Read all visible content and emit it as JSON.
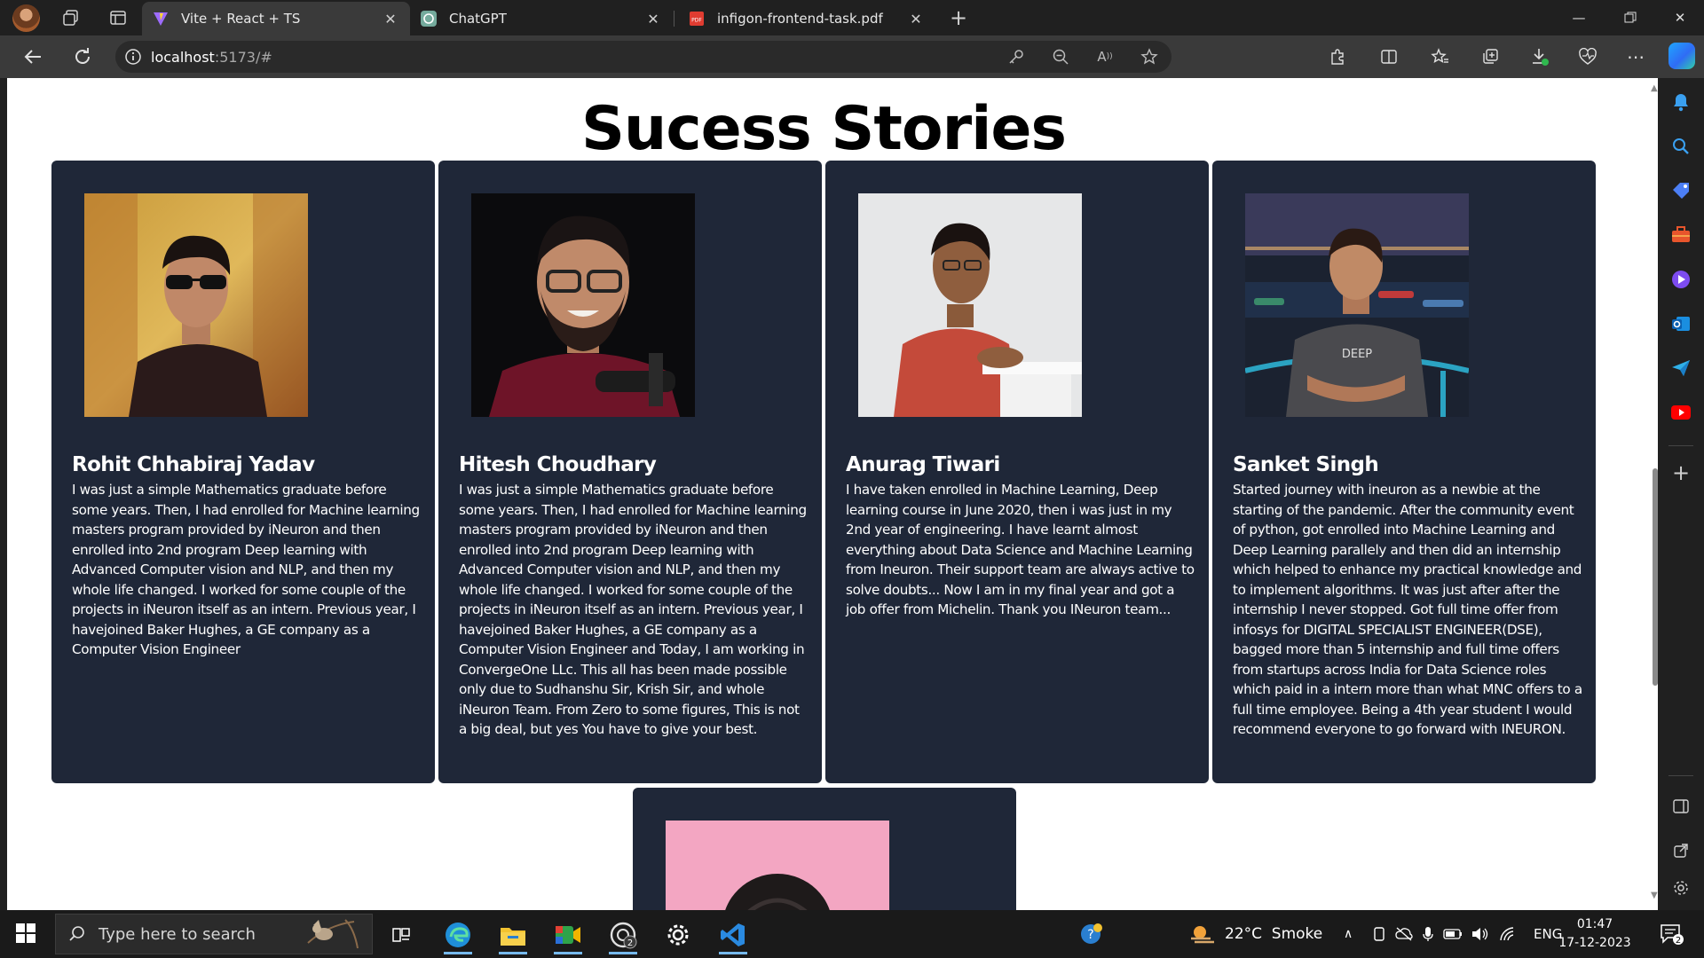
{
  "browser": {
    "tabs": [
      {
        "title": "Vite + React + TS",
        "active": true
      },
      {
        "title": "ChatGPT",
        "active": false
      },
      {
        "title": "infigon-frontend-task.pdf",
        "active": false
      }
    ],
    "address": {
      "host": "localhost",
      "rest": ":5173/#"
    }
  },
  "page": {
    "heading": "Sucess Stories",
    "cards": [
      {
        "name": "Rohit Chhabiraj Yadav",
        "story": "I was just a simple Mathematics graduate before some years. Then, I had enrolled for Machine learning masters program provided by iNeuron and then enrolled into 2nd program Deep learning with Advanced Computer vision and NLP, and then my whole life changed. I worked for some couple of the projects in iNeuron itself as an intern. Previous year, I havejoined Baker Hughes, a GE company as a Computer Vision Engineer"
      },
      {
        "name": "Hitesh Choudhary",
        "story": "I was just a simple Mathematics graduate before some years. Then, I had enrolled for Machine learning masters program provided by iNeuron and then enrolled into 2nd program Deep learning with Advanced Computer vision and NLP, and then my whole life changed. I worked for some couple of the projects in iNeuron itself as an intern. Previous year, I havejoined Baker Hughes, a GE company as a Computer Vision Engineer and Today, I am working in ConvergeOne LLc. This all has been made possible only due to Sudhanshu Sir, Krish Sir, and whole iNeuron Team. From Zero to some figures, This is not a big deal, but yes You have to give your best."
      },
      {
        "name": "Anurag Tiwari",
        "story": "I have taken enrolled in Machine Learning, Deep learning course in June 2020, then i was just in my 2nd year of engineering. I have learnt almost everything about Data Science and Machine Learning from Ineuron. Their support team are always active to solve doubts... Now I am in my final year and got a job offer from Michelin. Thank you INeuron team..."
      },
      {
        "name": "Sanket Singh",
        "story": "Started journey with ineuron as a newbie at the starting of the pandemic. After the community event of python, got enrolled into Machine Learning and Deep Learning parallely and then did an internship which helped to enhance my practical knowledge and to implement algorithms. It was just after after the internship I never stopped. Got full time offer from infosys for DIGITAL SPECIALIST ENGINEER(DSE), bagged more than 5 internship and full time offers from startups across India for Data Science roles which paid in a intern more than what MNC offers to a full time employee. Being a 4th year student I would recommend everyone to go forward with INEURON."
      }
    ]
  },
  "taskbar": {
    "search_placeholder": "Type here to search",
    "weather": "22°C  Smoke",
    "language": "ENG",
    "time": "01:47",
    "date": "17-12-2023",
    "notification_count": "2",
    "chat_badge": "2"
  },
  "colors": {
    "card_bg": "#1f2738",
    "page_bg": "#ffffff",
    "chrome_dark": "#202020",
    "toolbar": "#3a3a3a"
  }
}
